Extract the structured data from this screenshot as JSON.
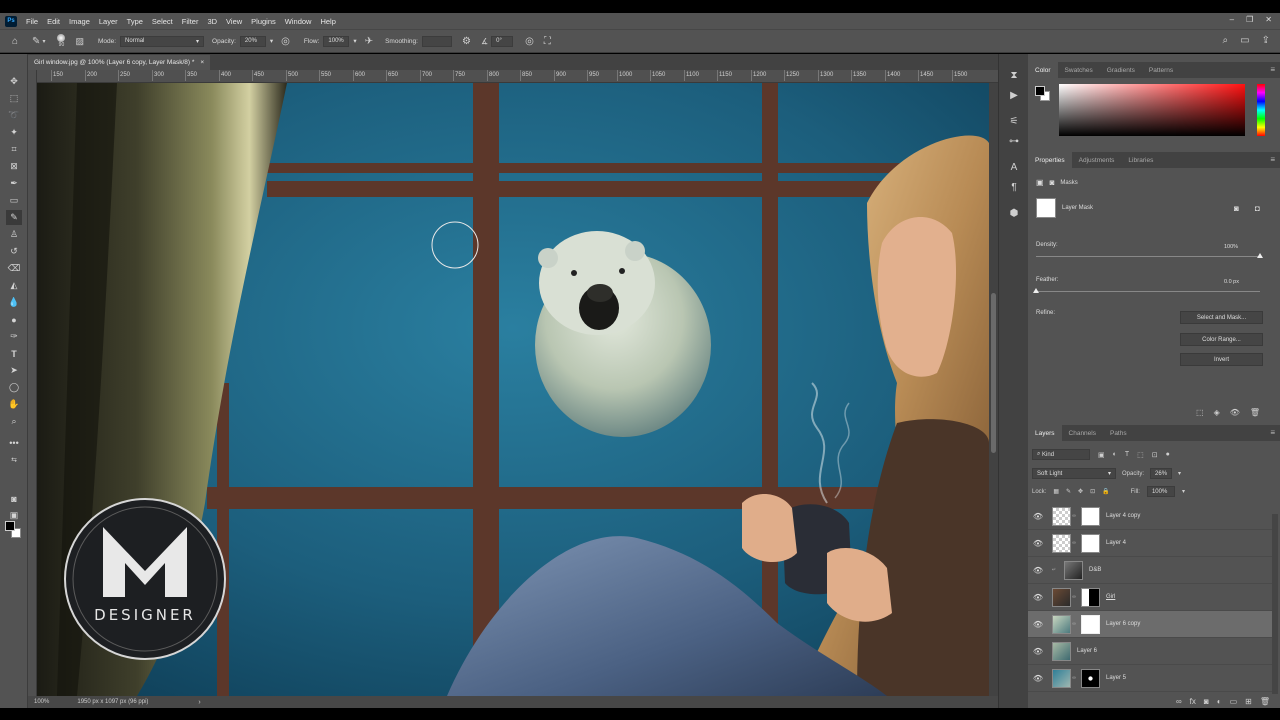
{
  "menu": {
    "items": [
      "File",
      "Edit",
      "Image",
      "Layer",
      "Type",
      "Select",
      "Filter",
      "3D",
      "View",
      "Plugins",
      "Window",
      "Help"
    ]
  },
  "options": {
    "brush_size": "90",
    "mode_label": "Mode:",
    "mode_value": "Normal",
    "opacity_label": "Opacity:",
    "opacity_value": "20%",
    "flow_label": "Flow:",
    "flow_value": "100%",
    "smoothing_label": "Smoothing:",
    "smoothing_value": "",
    "angle_value": "0°"
  },
  "document": {
    "tab_title": "Girl window.jpg @ 100% (Layer 6 copy, Layer Mask/8) *",
    "close_glyph": "×"
  },
  "ruler": {
    "ticks": [
      "150",
      "200",
      "250",
      "300",
      "350",
      "400",
      "450",
      "500",
      "550",
      "600",
      "650",
      "700",
      "750",
      "800",
      "850",
      "900",
      "950",
      "1000",
      "1050",
      "1100",
      "1150",
      "1200",
      "1250",
      "1300",
      "1350",
      "1400",
      "1450",
      "1500"
    ]
  },
  "status": {
    "zoom": "100%",
    "doc_info": "1950 px x 1097 px (96 ppi)"
  },
  "watermark": {
    "text": "DESIGNER"
  },
  "color_panel": {
    "tabs": [
      "Color",
      "Swatches",
      "Gradients",
      "Patterns"
    ]
  },
  "properties": {
    "tabs": [
      "Properties",
      "Adjustments",
      "Libraries"
    ],
    "masks_label": "Masks",
    "layer_mask_label": "Layer Mask",
    "density_label": "Density:",
    "density_value": "100%",
    "density_fraction": 1.0,
    "feather_label": "Feather:",
    "feather_value": "0.0 px",
    "feather_fraction": 0.0,
    "refine_label": "Refine:",
    "select_and_mask": "Select and Mask...",
    "color_range": "Color Range...",
    "invert": "Invert"
  },
  "layers_panel": {
    "tabs": [
      "Layers",
      "Channels",
      "Paths"
    ],
    "filter_kind": "Kind",
    "blend_mode": "Soft Light",
    "opacity_label": "Opacity:",
    "opacity_value": "26%",
    "lock_label": "Lock:",
    "fill_label": "Fill:",
    "fill_value": "100%",
    "layers": [
      {
        "name": "Layer 4 copy",
        "selected": false
      },
      {
        "name": "Layer 4",
        "selected": false
      },
      {
        "name": "D&B",
        "selected": false
      },
      {
        "name": "Girl",
        "selected": false
      },
      {
        "name": "Layer 6 copy",
        "selected": true
      },
      {
        "name": "Layer 6",
        "selected": false
      },
      {
        "name": "Layer 5",
        "selected": false
      }
    ]
  },
  "colors": {
    "ui_bg": "#535353",
    "ui_dark": "#424242",
    "underwater": "#1f5f7a",
    "frame": "#5a3529"
  }
}
